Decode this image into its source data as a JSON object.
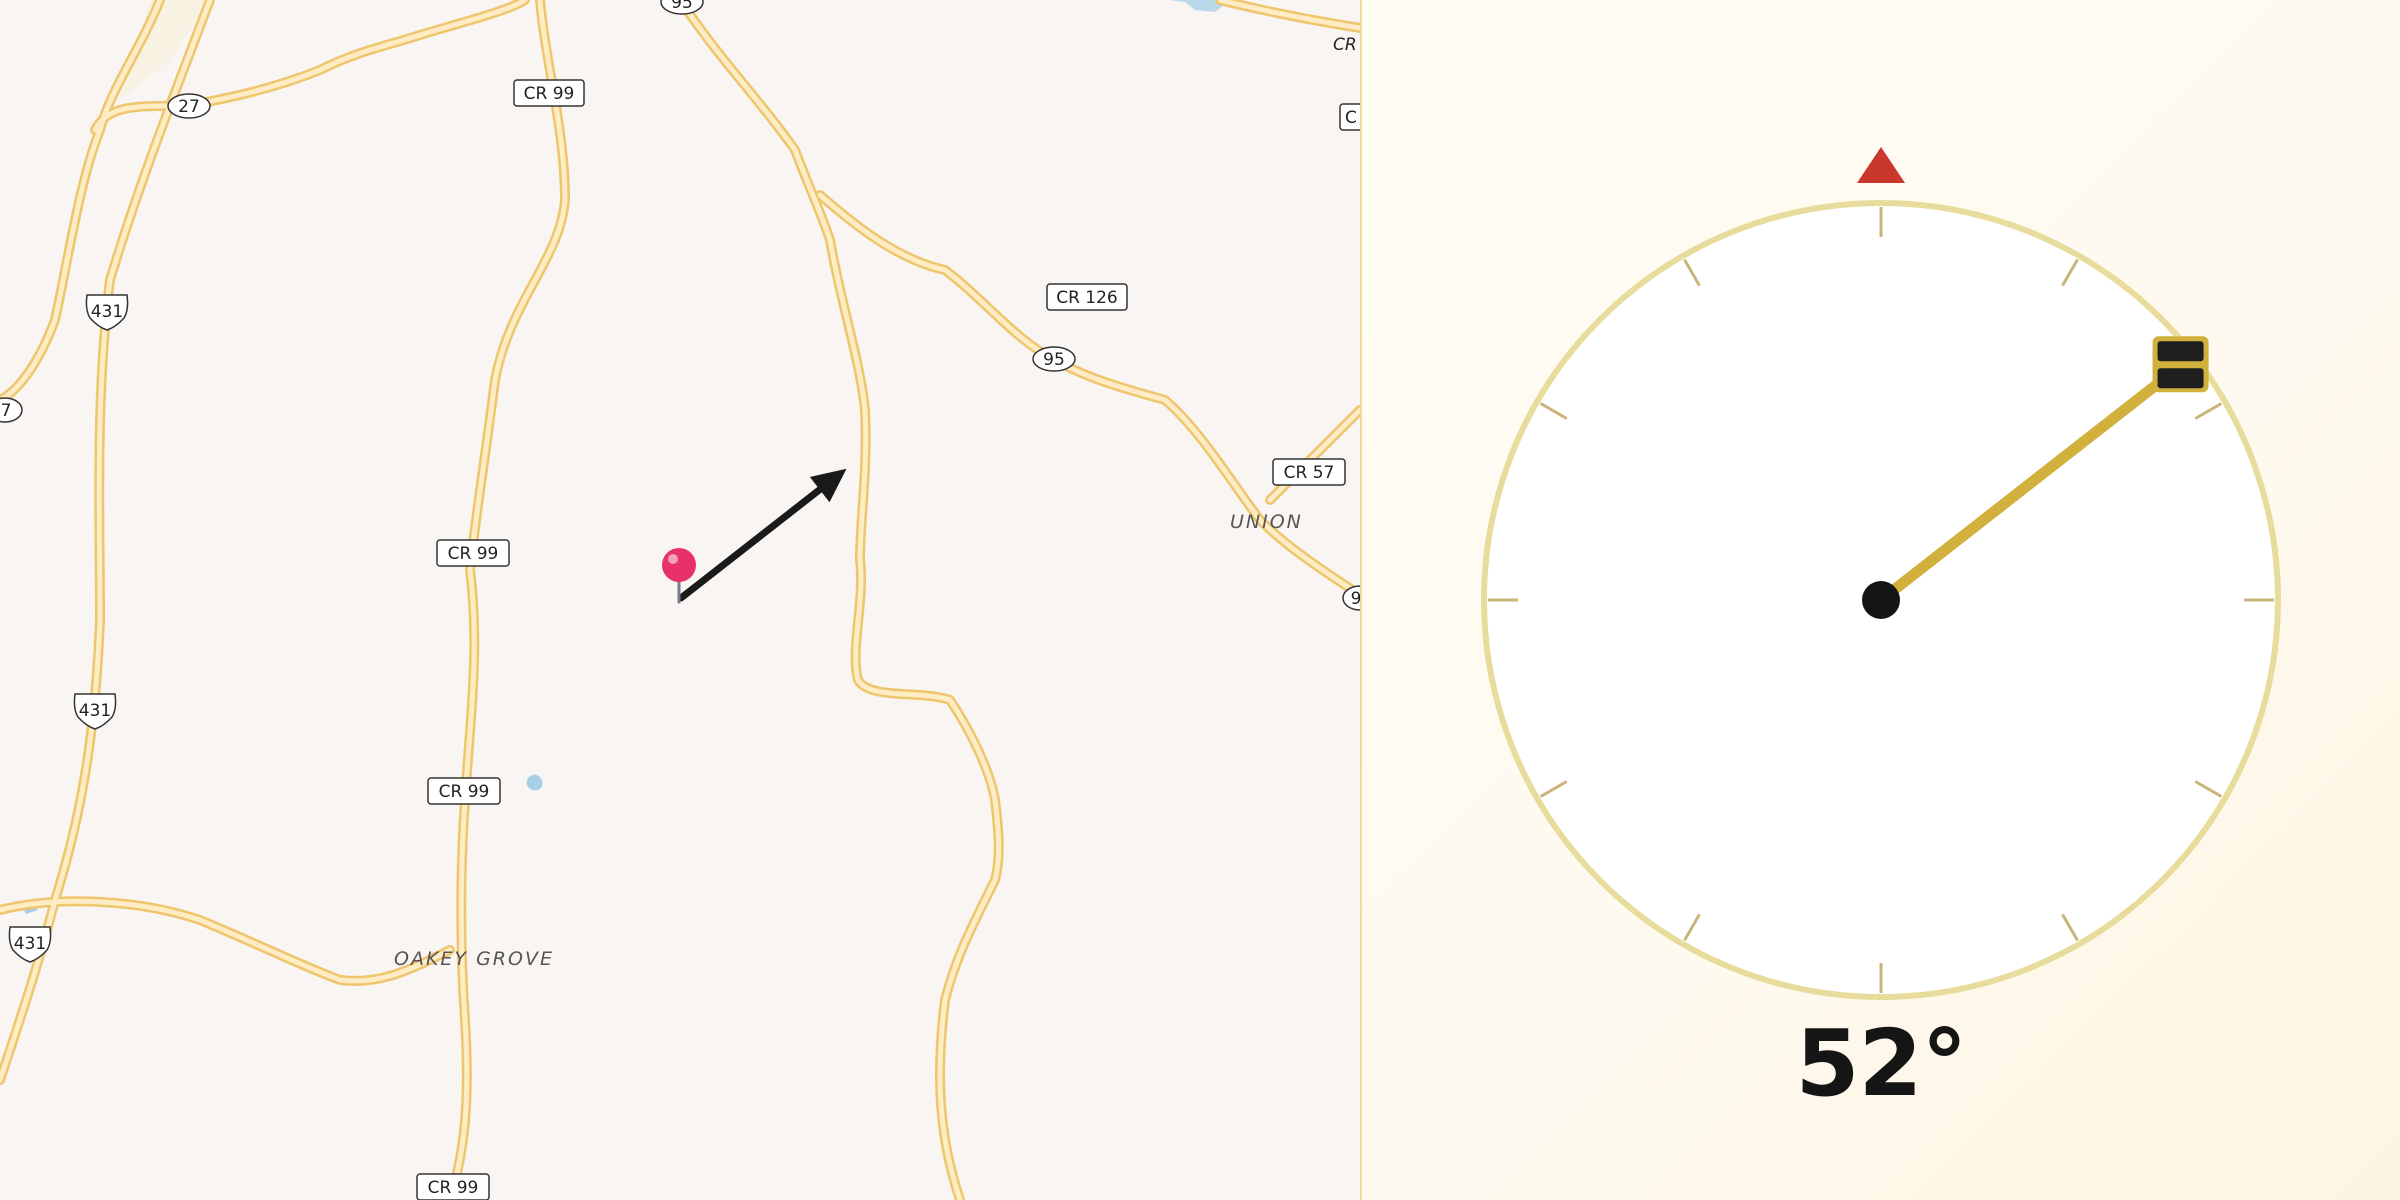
{
  "map": {
    "road_labels": [
      {
        "text": "CR 99",
        "kind": "county"
      },
      {
        "text": "CR 99",
        "kind": "county"
      },
      {
        "text": "CR 99",
        "kind": "county"
      },
      {
        "text": "CR 99",
        "kind": "county"
      },
      {
        "text": "CR 126",
        "kind": "county"
      },
      {
        "text": "CR 57",
        "kind": "county"
      },
      {
        "text": "CR",
        "kind": "county"
      },
      {
        "text": "C",
        "kind": "county"
      },
      {
        "text": "27",
        "kind": "state"
      },
      {
        "text": "95",
        "kind": "state"
      },
      {
        "text": "95",
        "kind": "state"
      },
      {
        "text": "7",
        "kind": "state"
      },
      {
        "text": "9",
        "kind": "state"
      },
      {
        "text": "431",
        "kind": "us"
      },
      {
        "text": "431",
        "kind": "us"
      },
      {
        "text": "431",
        "kind": "us"
      }
    ],
    "place_labels": [
      "UNION",
      "OAKEY GROVE"
    ],
    "marker": {
      "icon": "map-pin-icon",
      "color": "#e8306a"
    },
    "direction_arrow": {
      "icon": "arrow-icon",
      "heading_deg": 52,
      "color": "#1a1a1a"
    }
  },
  "compass": {
    "heading_deg": 52,
    "heading_text": "52°",
    "north_marker_color": "#c8382c",
    "needle_color": "#d1b13c",
    "ring_color": "#e8dc9c",
    "tick_color": "#c9b47a"
  }
}
